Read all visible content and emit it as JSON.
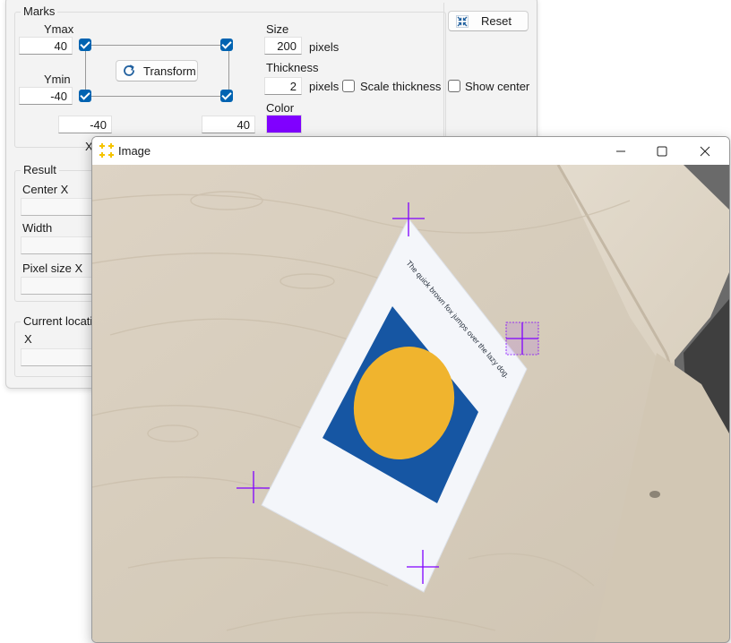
{
  "marks": {
    "title": "Marks",
    "ymax_label": "Ymax",
    "ymax_value": "40",
    "ymin_label": "Ymin",
    "ymin_value": "-40",
    "xmin_value": "-40",
    "xmax_value": "40",
    "x_label": "X",
    "transform_label": "Transform",
    "size_label": "Size",
    "size_value": "200",
    "size_unit": "pixels",
    "thickness_label": "Thickness",
    "thickness_value": "2",
    "thickness_unit": "pixels",
    "scale_thickness_label": "Scale thickness",
    "color_label": "Color",
    "color_value": "#8000ff",
    "reset_label": "Reset",
    "show_center_label": "Show center"
  },
  "result": {
    "title": "Result",
    "center_x_label": "Center X",
    "width_label": "Width",
    "pixel_size_x_label": "Pixel size X"
  },
  "current_location": {
    "title": "Current location",
    "x_label": "X"
  },
  "image_window": {
    "title": "Image",
    "icons": [
      "app-icon",
      "minimize-icon",
      "maximize-icon",
      "close-icon"
    ]
  },
  "photo": {
    "text": "The quick brown fox jumps over the lazy dog.",
    "paper_color": "#f4f6fa",
    "square_color": "#1656a3",
    "circle_color": "#f0b42e",
    "marker_color": "#8000ff"
  }
}
